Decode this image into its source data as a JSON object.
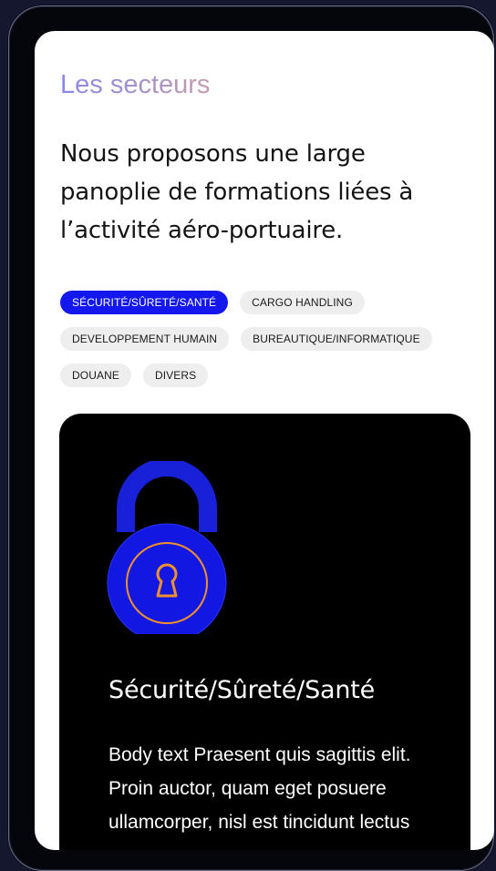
{
  "section": {
    "label": "Les secteurs",
    "intro": "Nous proposons une large panoplie de formations liées à l’activité aéro-portuaire."
  },
  "chips": {
    "row1": [
      {
        "label": "SÉCURITÉ/SÛRETÉ/SANTÉ",
        "active": true
      },
      {
        "label": "CARGO HANDLING",
        "active": false
      }
    ],
    "row2": [
      {
        "label": "DEVELOPPEMENT HUMAIN",
        "active": false
      },
      {
        "label": "BUREAUTIQUE/INFORMATIQUE",
        "active": false
      }
    ],
    "row3": [
      {
        "label": "DOUANE",
        "active": false
      },
      {
        "label": "DIVERS",
        "active": false
      }
    ]
  },
  "card": {
    "icon": "padlock-icon",
    "title": "Sécurité/Sûreté/Santé",
    "body": "Body text Praesent quis sagittis elit. Proin auctor, quam eget posuere ullamcorper, nisl est tincidunt lectus"
  },
  "colors": {
    "accent": "#1418ee",
    "chip_bg": "#eeeeee",
    "card_bg": "#000000",
    "lock_ring": "#f0902c"
  }
}
